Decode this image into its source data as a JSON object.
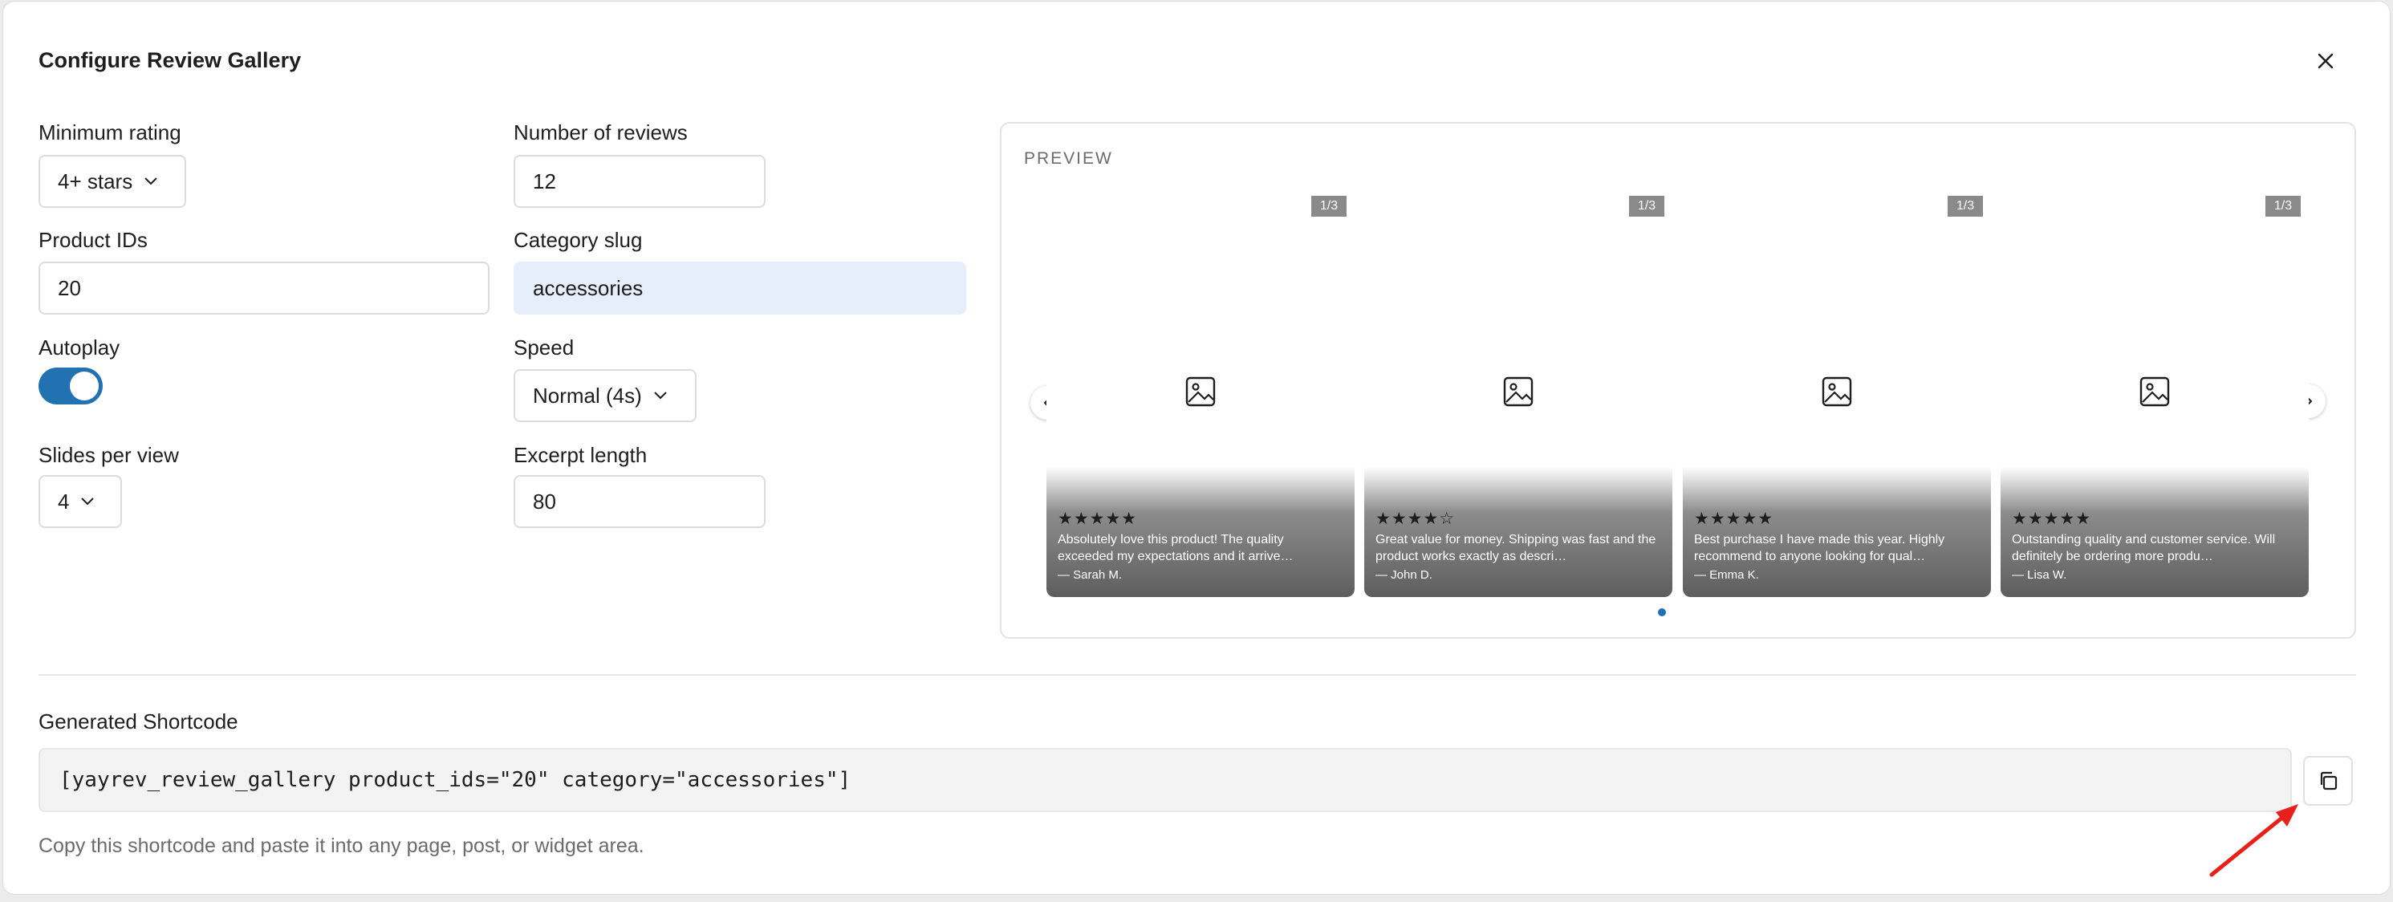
{
  "dialog": {
    "title": "Configure Review Gallery"
  },
  "form": {
    "min_rating": {
      "label": "Minimum rating",
      "value": "4+ stars"
    },
    "num_reviews": {
      "label": "Number of reviews",
      "value": "12"
    },
    "product_ids": {
      "label": "Product IDs",
      "value": "20"
    },
    "category_slug": {
      "label": "Category slug",
      "value": "accessories"
    },
    "autoplay": {
      "label": "Autoplay",
      "enabled": true
    },
    "speed": {
      "label": "Speed",
      "value": "Normal (4s)"
    },
    "slides_per_view": {
      "label": "Slides per view",
      "value": "4"
    },
    "excerpt_length": {
      "label": "Excerpt length",
      "value": "80"
    }
  },
  "preview": {
    "label": "PREVIEW",
    "slides": [
      {
        "counter": "1/3",
        "stars": "★★★★★",
        "excerpt": "Absolutely love this product! The quality exceeded my expectations and it arrive…",
        "author": "— Sarah M."
      },
      {
        "counter": "1/3",
        "stars": "★★★★☆",
        "excerpt": "Great value for money. Shipping was fast and the product works exactly as descri…",
        "author": "— John D."
      },
      {
        "counter": "1/3",
        "stars": "★★★★★",
        "excerpt": "Best purchase I have made this year. Highly recommend to anyone looking for qual…",
        "author": "— Emma K."
      },
      {
        "counter": "1/3",
        "stars": "★★★★★",
        "excerpt": "Outstanding quality and customer service. Will definitely be ordering more produ…",
        "author": "— Lisa W."
      }
    ]
  },
  "shortcode": {
    "label": "Generated Shortcode",
    "value": "[yayrev_review_gallery product_ids=\"20\" category=\"accessories\"]",
    "help": "Copy this shortcode and paste it into any page, post, or widget area."
  },
  "colors": {
    "accent": "#2271b1",
    "highlight_field": "#e6eefb",
    "annotation_arrow": "#e8201a"
  }
}
